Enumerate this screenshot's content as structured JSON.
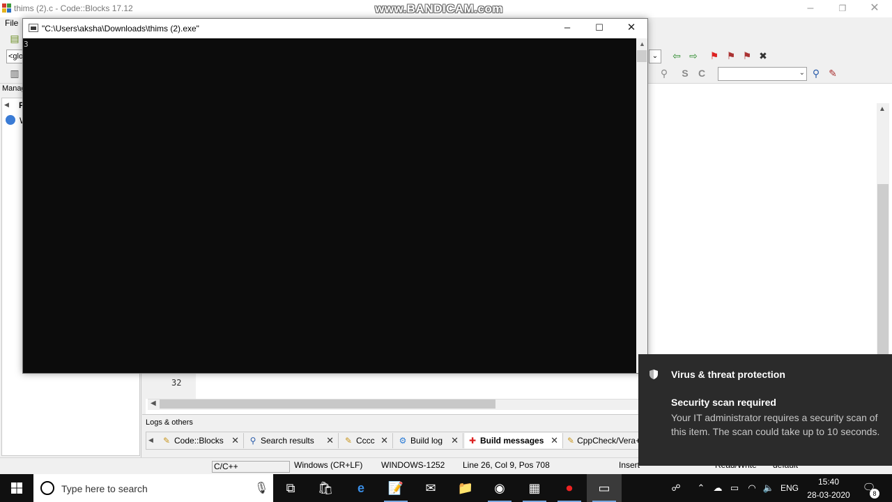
{
  "codeblocks": {
    "title": "thims (2).c - Code::Blocks 17.12",
    "menu_file": "File",
    "glob_combo": "<glo",
    "management_label": "Manag",
    "management_tab": "P",
    "workspace_item": "W",
    "line_number": "32",
    "logs_label": "Logs & others",
    "log_tabs": [
      {
        "label": "Code::Blocks",
        "icon": "pencil-doc-icon"
      },
      {
        "label": "Search results",
        "icon": "magnifier-icon"
      },
      {
        "label": "Cccc",
        "icon": "pencil-doc-icon"
      },
      {
        "label": "Build log",
        "icon": "gear-icon"
      },
      {
        "label": "Build messages",
        "icon": "pin-icon"
      },
      {
        "label": "CppCheck/Vera++",
        "icon": "pencil-doc-icon"
      }
    ],
    "status": {
      "language": "C/C++",
      "line_endings": "Windows (CR+LF)",
      "encoding": "WINDOWS-1252",
      "position": "Line 26, Col 9, Pos 708",
      "mode": "Insert",
      "access": "Read/Write",
      "profile": "default"
    }
  },
  "watermark": "www.BANDICAM.com",
  "console": {
    "title": "\"C:\\Users\\aksha\\Downloads\\thims (2).exe\"",
    "output": "3"
  },
  "toast": {
    "title": "Virus & threat protection",
    "heading": "Security scan required",
    "body": "Your IT administrator requires a security scan of this item.  The scan could take up to 10 seconds."
  },
  "taskbar": {
    "search_placeholder": "Type here to search",
    "language": "ENG",
    "time": "15:40",
    "date": "28-03-2020",
    "notification_count": "8"
  },
  "colors": {
    "console_bg": "#0c0c0c",
    "toast_bg": "#2b2b2b",
    "taskbar_bg": "#101010"
  }
}
